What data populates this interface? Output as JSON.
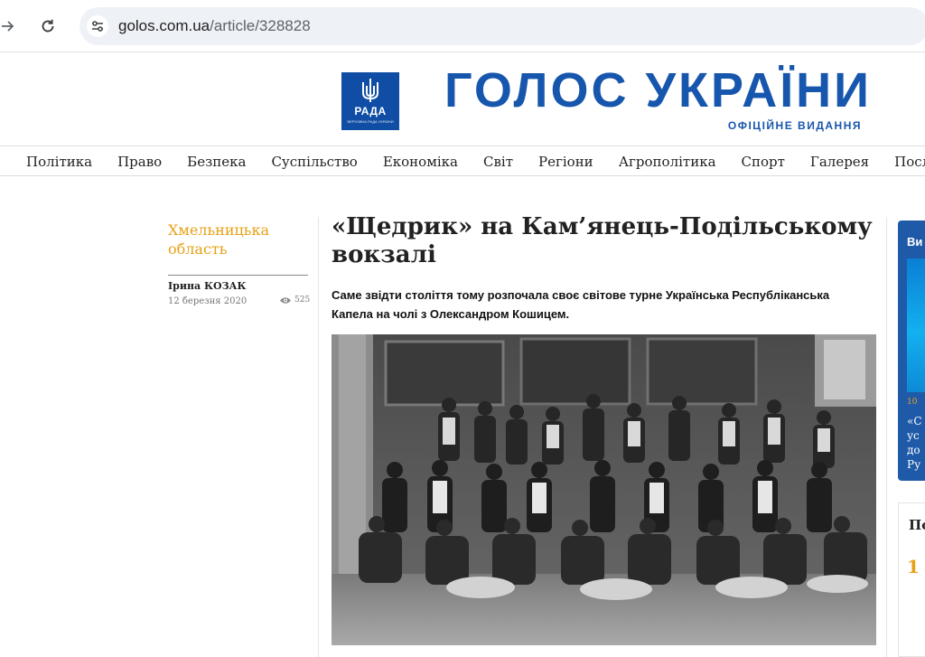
{
  "browser": {
    "url_domain": "golos.com.ua",
    "url_path": "/article/328828"
  },
  "masthead": {
    "logo_word": "РАДА",
    "logo_sub": "ВЕРХОВНА РАДА УКРАЇНИ",
    "title": "ГОЛОС УКРАЇНИ",
    "subtitle": "ОФІЦІЙНЕ ВИДАННЯ",
    "brand_color": "#1756ad"
  },
  "nav": {
    "items": [
      "Політика",
      "Право",
      "Безпека",
      "Суспільство",
      "Економіка",
      "Світ",
      "Регіони",
      "Агрополітика",
      "Спорт",
      "Галерея",
      "Послуги"
    ]
  },
  "article": {
    "region": "Хмельницька область",
    "author": "Ірина КОЗАК",
    "date": "12 березня 2020",
    "views": "525",
    "title": "«Щедрик» на Кам’янець-Подільському вокзалі",
    "lead": "Саме звідти століття тому розпочала своє світове турне Українська Республіканська Капела на чолі з Олександром Кошицем.",
    "accent_color": "#e6a117"
  },
  "sidebar": {
    "card_label": "Ви",
    "card_date": "10",
    "card_text_lines": [
      "«С",
      "ус",
      "до",
      "Ру"
    ],
    "box_title": "По",
    "box_number": "1"
  }
}
